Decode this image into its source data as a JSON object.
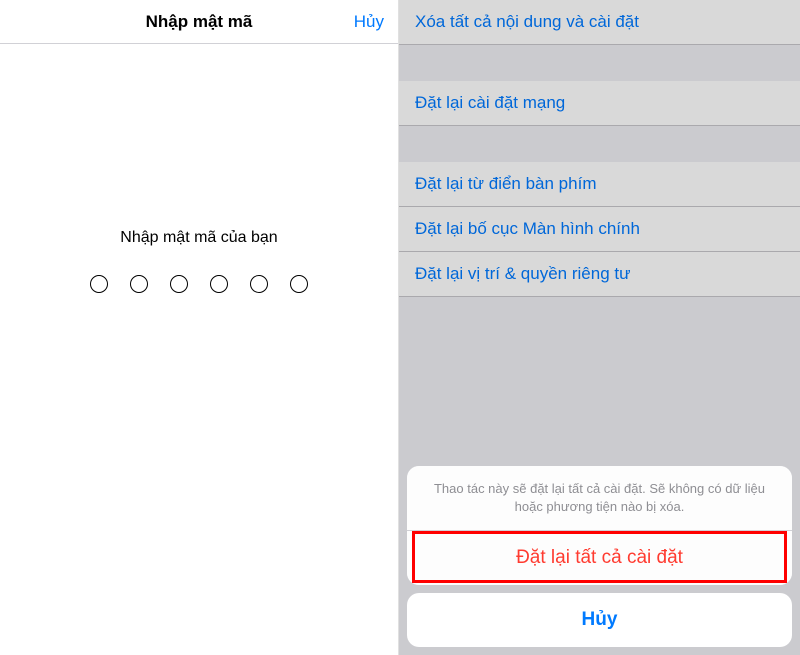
{
  "left": {
    "nav": {
      "title": "Nhập mật mã",
      "cancel": "Hủy"
    },
    "prompt": "Nhập mật mã của bạn"
  },
  "right": {
    "settings": {
      "items": [
        {
          "label": "Xóa tất cả nội dung và cài đặt"
        },
        {
          "label": "Đặt lại cài đặt mạng"
        },
        {
          "label": "Đặt lại từ điển bàn phím"
        },
        {
          "label": "Đặt lại bố cục Màn hình chính"
        },
        {
          "label": "Đặt lại vị trí & quyền riêng tư"
        }
      ]
    },
    "actionSheet": {
      "message": "Thao tác này sẽ đặt lại tất cả cài đặt. Sẽ không có dữ liệu hoặc phương tiện nào bị xóa.",
      "confirmLabel": "Đặt lại tất cả cài đặt",
      "cancelLabel": "Hủy"
    }
  }
}
